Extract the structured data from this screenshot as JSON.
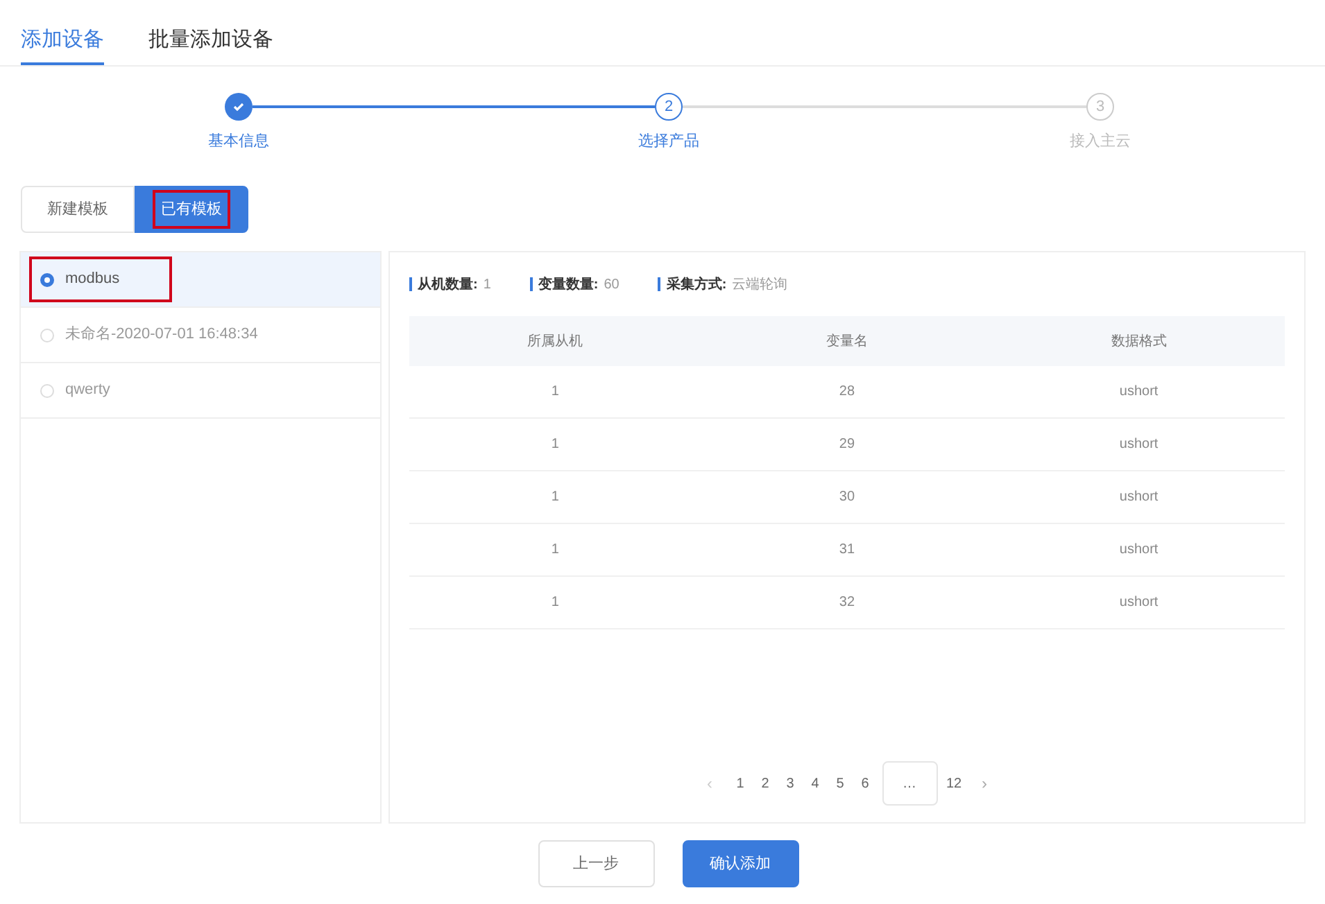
{
  "tabs": [
    {
      "label": "添加设备",
      "selected": true
    },
    {
      "label": "批量添加设备",
      "selected": false
    }
  ],
  "steps": [
    {
      "label": "基本信息",
      "done": true,
      "active": false
    },
    {
      "label": "选择产品",
      "number": "2",
      "done": false,
      "active": true
    },
    {
      "label": "接入主云",
      "number": "3",
      "done": false,
      "active": false
    }
  ],
  "template_tabs": [
    {
      "label": "新建模板",
      "selected": false,
      "highlighted": false
    },
    {
      "label": "已有模板",
      "selected": true,
      "highlighted": true
    }
  ],
  "templates": [
    {
      "name": "modbus",
      "selected": true,
      "highlighted": true
    },
    {
      "name": "未命名-2020-07-01 16:48:34",
      "selected": false,
      "highlighted": false
    },
    {
      "name": "qwerty",
      "selected": false,
      "highlighted": false
    }
  ],
  "summary": [
    {
      "label": "从机数量:",
      "value": "1"
    },
    {
      "label": "变量数量:",
      "value": "60"
    },
    {
      "label": "采集方式:",
      "value": "云端轮询"
    }
  ],
  "table": {
    "columns": [
      "所属从机",
      "变量名",
      "数据格式"
    ],
    "rows": [
      [
        "1",
        "28",
        "ushort"
      ],
      [
        "1",
        "29",
        "ushort"
      ],
      [
        "1",
        "30",
        "ushort"
      ],
      [
        "1",
        "31",
        "ushort"
      ],
      [
        "1",
        "32",
        "ushort"
      ]
    ]
  },
  "pagination": {
    "prev": "‹",
    "pages": [
      {
        "label": "1",
        "selected": false
      },
      {
        "label": "2",
        "selected": false
      },
      {
        "label": "3",
        "selected": false
      },
      {
        "label": "4",
        "selected": false
      },
      {
        "label": "5",
        "selected": false
      },
      {
        "label": "6",
        "selected": false
      },
      {
        "label": "…",
        "selected": false,
        "kind": "ellipsis"
      },
      {
        "label": "12",
        "selected": false
      }
    ],
    "next": "›"
  },
  "buttons": [
    {
      "label": "上一步",
      "kind": "secondary"
    },
    {
      "label": "确认添加",
      "kind": "primary"
    }
  ]
}
